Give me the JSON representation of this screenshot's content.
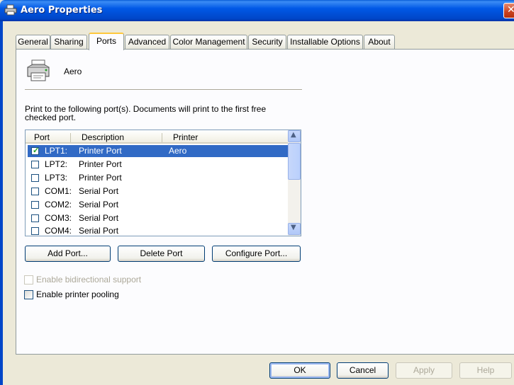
{
  "window": {
    "title": "Aero Properties"
  },
  "tabs": [
    {
      "label": "General"
    },
    {
      "label": "Sharing"
    },
    {
      "label": "Ports"
    },
    {
      "label": "Advanced"
    },
    {
      "label": "Color Management"
    },
    {
      "label": "Security"
    },
    {
      "label": "Installable Options"
    },
    {
      "label": "About"
    }
  ],
  "active_tab": "Ports",
  "printer": {
    "name": "Aero",
    "icon": "printer-icon"
  },
  "instruction": {
    "line1": "Print to the following port(s). Documents will print to the first free",
    "line2": "checked port."
  },
  "port_list": {
    "columns": [
      "Port",
      "Description",
      "Printer"
    ],
    "rows": [
      {
        "port": "LPT1:",
        "description": "Printer Port",
        "printer": "Aero",
        "checked": true,
        "selected": true
      },
      {
        "port": "LPT2:",
        "description": "Printer Port",
        "printer": "",
        "checked": false,
        "selected": false
      },
      {
        "port": "LPT3:",
        "description": "Printer Port",
        "printer": "",
        "checked": false,
        "selected": false
      },
      {
        "port": "COM1:",
        "description": "Serial Port",
        "printer": "",
        "checked": false,
        "selected": false
      },
      {
        "port": "COM2:",
        "description": "Serial Port",
        "printer": "",
        "checked": false,
        "selected": false
      },
      {
        "port": "COM3:",
        "description": "Serial Port",
        "printer": "",
        "checked": false,
        "selected": false
      },
      {
        "port": "COM4:",
        "description": "Serial Port",
        "printer": "",
        "checked": false,
        "selected": false
      }
    ]
  },
  "port_buttons": {
    "add": "Add Port...",
    "delete": "Delete Port",
    "configure": "Configure Port..."
  },
  "options": {
    "bidirectional": {
      "label": "Enable bidirectional support",
      "checked": false,
      "enabled": false
    },
    "pooling": {
      "label": "Enable printer pooling",
      "checked": false,
      "enabled": true
    }
  },
  "dialog_buttons": {
    "ok": "OK",
    "cancel": "Cancel",
    "apply": "Apply",
    "help": "Help"
  },
  "colors": {
    "titlebar": "#0058e6",
    "selection": "#316ac5",
    "dialog_bg": "#ece9d8",
    "tab_highlight": "#ffc83c"
  }
}
